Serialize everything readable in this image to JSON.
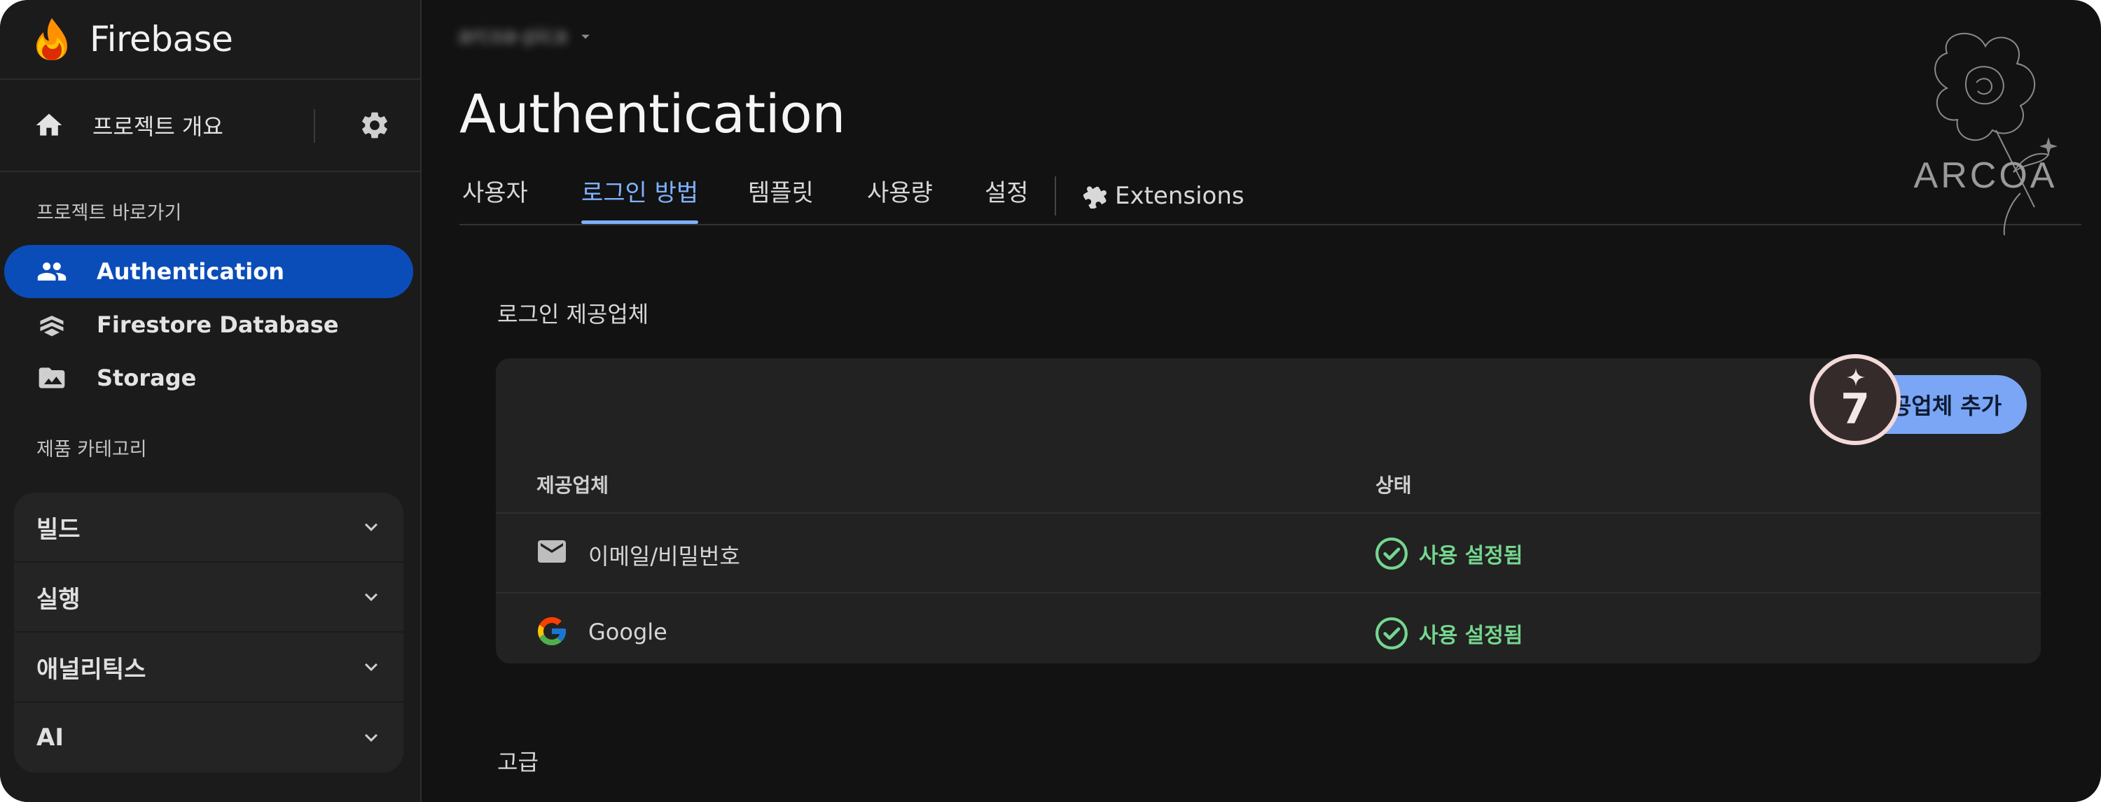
{
  "app": {
    "brand": "Firebase",
    "project_name": "arcoa-pica"
  },
  "sidebar": {
    "overview_label": "프로젝트 개요",
    "shortcuts_label": "프로젝트 바로가기",
    "items": [
      {
        "label": "Authentication",
        "icon": "people-icon",
        "active": true
      },
      {
        "label": "Firestore Database",
        "icon": "firestore-icon",
        "active": false
      },
      {
        "label": "Storage",
        "icon": "storage-icon",
        "active": false
      }
    ],
    "categories_label": "제품 카테고리",
    "groups": [
      {
        "label": "빌드"
      },
      {
        "label": "실행"
      },
      {
        "label": "애널리틱스"
      },
      {
        "label": "AI"
      }
    ]
  },
  "main": {
    "title": "Authentication",
    "tabs": [
      {
        "label": "사용자",
        "active": false
      },
      {
        "label": "로그인 방법",
        "active": true
      },
      {
        "label": "템플릿",
        "active": false
      },
      {
        "label": "사용량",
        "active": false
      },
      {
        "label": "설정",
        "active": false
      }
    ],
    "extensions_label": "Extensions",
    "providers_section_title": "로그인 제공업체",
    "add_provider_label": "새 제공업체 추가",
    "step_badge": "7",
    "table": {
      "headers": [
        "제공업체",
        "상태"
      ],
      "rows": [
        {
          "provider": "이메일/비밀번호",
          "icon": "mail-icon",
          "status": "사용 설정됨"
        },
        {
          "provider": "Google",
          "icon": "google-icon",
          "status": "사용 설정됨"
        }
      ]
    },
    "advanced_section_title": "고급"
  },
  "watermark": "ARCOA",
  "colors": {
    "accent": "#7fb1ff",
    "active_nav": "#0b4db8",
    "enabled_status": "#75d68f",
    "button": "#7aa6f5"
  }
}
